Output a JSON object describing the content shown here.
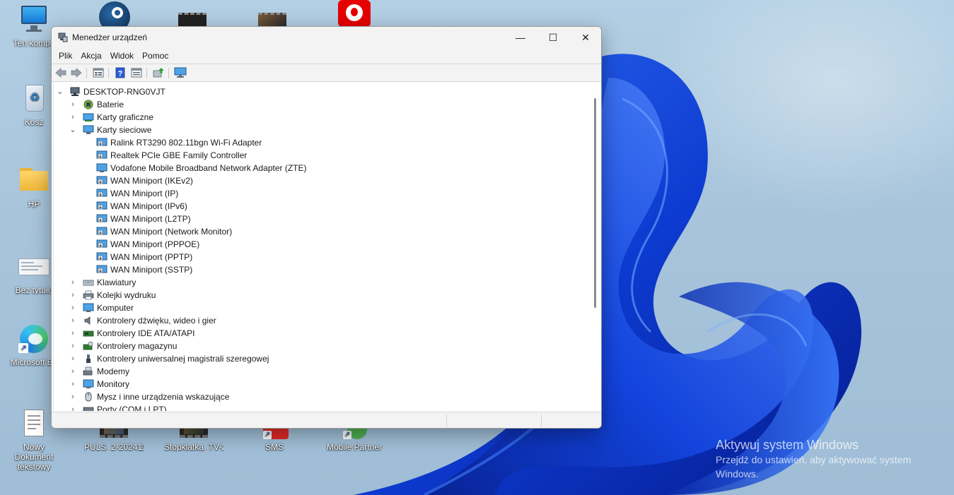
{
  "desktop": {
    "icons": [
      {
        "label": "Ten kompu"
      },
      {
        "label": "Kosz"
      },
      {
        "label": "HP"
      },
      {
        "label": "Bez tytułu"
      },
      {
        "label": "Microsoft Ed"
      },
      {
        "label": "Nowy Dokument tekstowy"
      },
      {
        "label": "PULS_2-2024110121..."
      },
      {
        "label": "Stopklatka_TV-202..."
      },
      {
        "label": "SMS"
      },
      {
        "label": "Mobile Partner"
      }
    ],
    "watermark": {
      "title": "Aktywuj system Windows",
      "subtitle_line1": "Przejdź do ustawień, aby aktywować system",
      "subtitle_line2": "Windows."
    }
  },
  "window": {
    "title": "Menedżer urządzeń",
    "controls": {
      "minimize": "—",
      "maximize": "☐",
      "close": "✕"
    },
    "menu": [
      "Plik",
      "Akcja",
      "Widok",
      "Pomoc"
    ],
    "toolbar": [
      "back-icon",
      "forward-icon",
      "properties-icon",
      "help-icon",
      "details-icon",
      "update-driver-icon",
      "monitor-icon"
    ],
    "tree": {
      "root": "DESKTOP-RNG0VJT",
      "categories_before": [
        {
          "label": "Baterie",
          "icon": "battery-icon",
          "expanded": false
        },
        {
          "label": "Karty graficzne",
          "icon": "display-adapter-icon",
          "expanded": false
        },
        {
          "label": "Karty sieciowe",
          "icon": "network-adapter-icon",
          "expanded": true
        }
      ],
      "network_adapters": [
        "Ralink RT3290 802.11bgn Wi-Fi Adapter",
        "Realtek PCIe GBE Family Controller",
        "Vodafone Mobile Broadband Network Adapter (ZTE)",
        "WAN Miniport (IKEv2)",
        "WAN Miniport (IP)",
        "WAN Miniport (IPv6)",
        "WAN Miniport (L2TP)",
        "WAN Miniport (Network Monitor)",
        "WAN Miniport (PPPOE)",
        "WAN Miniport (PPTP)",
        "WAN Miniport (SSTP)"
      ],
      "categories_after": [
        {
          "label": "Klawiatury",
          "icon": "keyboard-icon"
        },
        {
          "label": "Kolejki wydruku",
          "icon": "printer-icon"
        },
        {
          "label": "Komputer",
          "icon": "computer-icon"
        },
        {
          "label": "Kontrolery dźwięku, wideo i gier",
          "icon": "speaker-icon"
        },
        {
          "label": "Kontrolery IDE ATA/ATAPI",
          "icon": "ide-controller-icon"
        },
        {
          "label": "Kontrolery magazynu",
          "icon": "storage-controller-icon"
        },
        {
          "label": "Kontrolery uniwersalnej magistrali szeregowej",
          "icon": "usb-icon"
        },
        {
          "label": "Modemy",
          "icon": "modem-icon"
        },
        {
          "label": "Monitory",
          "icon": "monitor-icon"
        },
        {
          "label": "Mysz i inne urządzenia wskazujące",
          "icon": "mouse-icon"
        },
        {
          "label": "Porty (COM i LPT)",
          "icon": "port-icon"
        }
      ]
    }
  }
}
